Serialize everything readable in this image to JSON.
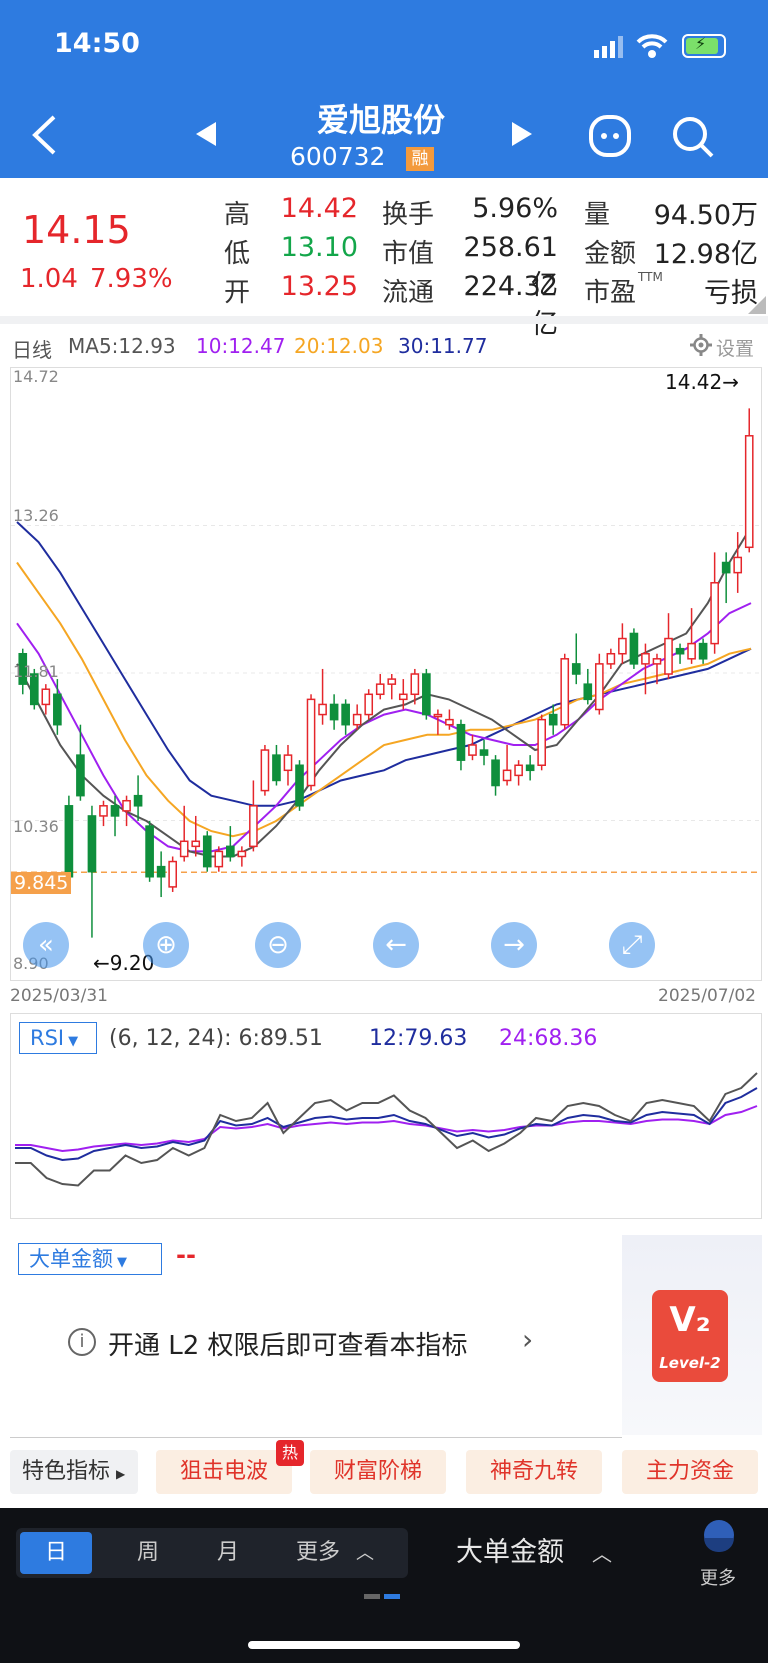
{
  "status_bar": {
    "time": "14:50"
  },
  "header": {
    "stock_name": "爱旭股份",
    "stock_code": "600732",
    "margin_badge": "融"
  },
  "quote": {
    "price": "14.15",
    "change": "1.04",
    "change_pct": "7.93%",
    "high_label": "高",
    "high": "14.42",
    "low_label": "低",
    "low": "13.10",
    "open_label": "开",
    "open": "13.25",
    "turnover_label": "换手",
    "turnover": "5.96%",
    "mktcap_label": "市值",
    "mktcap": "258.61亿",
    "float_label": "流通",
    "float": "224.32亿",
    "volume_label": "量",
    "volume": "94.50万",
    "amount_label": "金额",
    "amount": "12.98亿",
    "pe_label": "市盈",
    "pe_sup": "TTM",
    "pe": "亏损"
  },
  "kline": {
    "period": "日线",
    "ma5": "MA5:12.93",
    "ma10": "10:12.47",
    "ma20": "20:12.03",
    "ma30": "30:11.77",
    "settings": "设置",
    "y_labels": [
      "14.72",
      "13.26",
      "11.81",
      "10.36",
      "8.90"
    ],
    "price_tag": "9.845",
    "max_marker": "14.42→",
    "min_marker": "←9.20",
    "date_start": "2025/03/31",
    "date_end": "2025/07/02",
    "colors": {
      "ma5": "#555555",
      "ma10": "#a020f0",
      "ma20": "#f5a623",
      "ma30": "#1f2d9e",
      "up": "#e5262b",
      "down": "#0f8f3c"
    }
  },
  "rsi": {
    "selector": "RSI",
    "params": "(6, 12, 24): 6:89.51",
    "v12": "12:79.63",
    "v24": "24:68.36"
  },
  "big_order": {
    "selector": "大单金额",
    "value": "--",
    "message": "开通 L2 权限后即可查看本指标",
    "badge": "Level-2"
  },
  "feature_tags": {
    "label": "特色指标",
    "items": [
      "狙击电波",
      "财富阶梯",
      "神奇九转",
      "主力资金"
    ],
    "hot": "热"
  },
  "bottom_bar": {
    "period_tabs": [
      "日",
      "周",
      "月",
      "更多"
    ],
    "indicator": "大单金额",
    "more": "更多"
  },
  "chart_data": {
    "type": "candlestick",
    "x_range": [
      "2025/03/31",
      "2025/07/02"
    ],
    "ylim": [
      8.9,
      14.72
    ],
    "candles": [
      [
        12.0,
        11.7,
        12.05,
        11.6
      ],
      [
        11.8,
        11.5,
        11.85,
        11.45
      ],
      [
        11.5,
        11.65,
        11.7,
        11.4
      ],
      [
        11.6,
        11.3,
        11.75,
        11.2
      ],
      [
        10.5,
        9.8,
        10.6,
        9.75
      ],
      [
        11.0,
        10.6,
        11.3,
        10.55
      ],
      [
        10.4,
        9.85,
        10.5,
        9.2
      ],
      [
        10.4,
        10.5,
        10.55,
        10.3
      ],
      [
        10.5,
        10.4,
        10.6,
        10.2
      ],
      [
        10.45,
        10.55,
        10.6,
        10.3
      ],
      [
        10.6,
        10.5,
        10.8,
        10.35
      ],
      [
        10.3,
        9.8,
        10.35,
        9.75
      ],
      [
        9.9,
        9.8,
        10.05,
        9.6
      ],
      [
        9.7,
        9.95,
        10.0,
        9.65
      ],
      [
        10.0,
        10.15,
        10.5,
        9.95
      ],
      [
        10.1,
        10.15,
        10.4,
        10.0
      ],
      [
        10.2,
        9.9,
        10.25,
        9.85
      ],
      [
        9.9,
        10.05,
        10.1,
        9.85
      ],
      [
        10.1,
        10.0,
        10.3,
        9.95
      ],
      [
        10.0,
        10.05,
        10.1,
        9.9
      ],
      [
        10.1,
        10.5,
        10.75,
        10.05
      ],
      [
        10.65,
        11.05,
        11.1,
        10.6
      ],
      [
        11.0,
        10.75,
        11.1,
        10.7
      ],
      [
        10.85,
        11.0,
        11.1,
        10.7
      ],
      [
        10.9,
        10.5,
        10.95,
        10.45
      ],
      [
        10.7,
        11.55,
        11.6,
        10.65
      ],
      [
        11.4,
        11.5,
        11.85,
        11.3
      ],
      [
        11.5,
        11.35,
        11.6,
        11.25
      ],
      [
        11.5,
        11.3,
        11.55,
        11.2
      ],
      [
        11.3,
        11.4,
        11.5,
        11.25
      ],
      [
        11.4,
        11.6,
        11.65,
        11.35
      ],
      [
        11.6,
        11.7,
        11.8,
        11.55
      ],
      [
        11.7,
        11.75,
        11.8,
        11.55
      ],
      [
        11.55,
        11.6,
        11.75,
        11.45
      ],
      [
        11.6,
        11.8,
        11.85,
        11.5
      ],
      [
        11.8,
        11.4,
        11.85,
        11.35
      ],
      [
        11.4,
        11.4,
        11.45,
        11.2
      ],
      [
        11.3,
        11.35,
        11.45,
        11.25
      ],
      [
        11.3,
        10.95,
        11.35,
        10.85
      ],
      [
        11.0,
        11.1,
        11.2,
        10.95
      ],
      [
        11.05,
        11.0,
        11.15,
        10.9
      ],
      [
        10.95,
        10.7,
        11.0,
        10.6
      ],
      [
        10.75,
        10.85,
        11.1,
        10.7
      ],
      [
        10.8,
        10.9,
        10.95,
        10.7
      ],
      [
        10.9,
        10.85,
        11.0,
        10.75
      ],
      [
        10.9,
        11.35,
        11.4,
        10.85
      ],
      [
        11.4,
        11.3,
        11.5,
        11.2
      ],
      [
        11.3,
        11.95,
        12.0,
        11.25
      ],
      [
        11.9,
        11.8,
        12.2,
        11.7
      ],
      [
        11.7,
        11.55,
        11.85,
        11.5
      ],
      [
        11.45,
        11.9,
        12.0,
        11.4
      ],
      [
        11.9,
        12.0,
        12.05,
        11.85
      ],
      [
        12.0,
        12.15,
        12.3,
        11.9
      ],
      [
        12.2,
        11.9,
        12.25,
        11.85
      ],
      [
        11.9,
        12.0,
        12.1,
        11.6
      ],
      [
        11.9,
        11.95,
        12.0,
        11.7
      ],
      [
        11.8,
        12.15,
        12.4,
        11.75
      ],
      [
        12.05,
        12.0,
        12.1,
        11.9
      ],
      [
        11.95,
        12.1,
        12.45,
        11.9
      ],
      [
        12.1,
        11.95,
        12.15,
        11.9
      ],
      [
        12.1,
        12.7,
        13.0,
        12.0
      ],
      [
        12.9,
        12.8,
        13.0,
        12.5
      ],
      [
        12.8,
        12.95,
        13.2,
        12.6
      ],
      [
        13.05,
        14.15,
        14.42,
        13.0
      ]
    ],
    "ma_lines": {
      "ma5": [
        11.9,
        11.5,
        11.1,
        10.8,
        10.6,
        10.45,
        10.35,
        10.2,
        10.05,
        10.0,
        10.0,
        10.1,
        10.3,
        10.55,
        10.85,
        11.1,
        11.3,
        11.45,
        11.5,
        11.6,
        11.55,
        11.45,
        11.35,
        11.2,
        11.05,
        11.1,
        11.35,
        11.6,
        11.9,
        12.0,
        12.1,
        12.2,
        12.5,
        12.9,
        13.25
      ],
      "ma10": [
        12.3,
        12.0,
        11.6,
        11.2,
        10.8,
        10.45,
        10.25,
        10.1,
        10.05,
        10.05,
        10.1,
        10.3,
        10.5,
        10.75,
        10.95,
        11.15,
        11.3,
        11.4,
        11.45,
        11.4,
        11.3,
        11.2,
        11.15,
        11.1,
        11.1,
        11.2,
        11.35,
        11.55,
        11.7,
        11.85,
        11.95,
        12.05,
        12.2,
        12.4,
        12.5
      ],
      "ma20": [
        12.9,
        12.6,
        12.3,
        11.95,
        11.55,
        11.15,
        10.8,
        10.55,
        10.35,
        10.25,
        10.2,
        10.25,
        10.35,
        10.5,
        10.65,
        10.8,
        10.95,
        11.1,
        11.15,
        11.2,
        11.2,
        11.25,
        11.25,
        11.3,
        11.35,
        11.45,
        11.55,
        11.6,
        11.7,
        11.75,
        11.8,
        11.85,
        11.9,
        12.0,
        12.05
      ],
      "ma30": [
        13.3,
        13.1,
        12.8,
        12.45,
        12.1,
        11.75,
        11.4,
        11.05,
        10.75,
        10.6,
        10.55,
        10.5,
        10.5,
        10.55,
        10.65,
        10.75,
        10.8,
        10.85,
        10.95,
        11.0,
        11.05,
        11.1,
        11.2,
        11.3,
        11.4,
        11.5,
        11.55,
        11.6,
        11.65,
        11.7,
        11.75,
        11.8,
        11.85,
        11.95,
        12.05
      ]
    },
    "rsi": {
      "rsi6": [
        30,
        30,
        20,
        16,
        15,
        25,
        25,
        35,
        30,
        32,
        40,
        35,
        40,
        62,
        58,
        60,
        70,
        50,
        60,
        70,
        72,
        65,
        70,
        70,
        75,
        65,
        60,
        50,
        40,
        45,
        38,
        43,
        50,
        60,
        58,
        68,
        70,
        68,
        62,
        58,
        70,
        72,
        70,
        68,
        58,
        76,
        80,
        90
      ],
      "rsi12": [
        40,
        40,
        35,
        32,
        33,
        38,
        40,
        42,
        40,
        41,
        44,
        42,
        45,
        58,
        55,
        56,
        60,
        54,
        57,
        60,
        61,
        59,
        60,
        60,
        62,
        58,
        56,
        52,
        48,
        50,
        47,
        49,
        53,
        56,
        55,
        60,
        62,
        61,
        58,
        57,
        62,
        64,
        63,
        62,
        56,
        70,
        74,
        80
      ],
      "rsi24": [
        42,
        42,
        40,
        38,
        39,
        41,
        42,
        43,
        42,
        43,
        45,
        44,
        46,
        54,
        53,
        54,
        56,
        53,
        55,
        56,
        57,
        56,
        57,
        57,
        58,
        56,
        55,
        53,
        51,
        52,
        51,
        52,
        54,
        55,
        55,
        57,
        58,
        58,
        57,
        56,
        58,
        59,
        59,
        58,
        56,
        62,
        64,
        68
      ]
    }
  }
}
